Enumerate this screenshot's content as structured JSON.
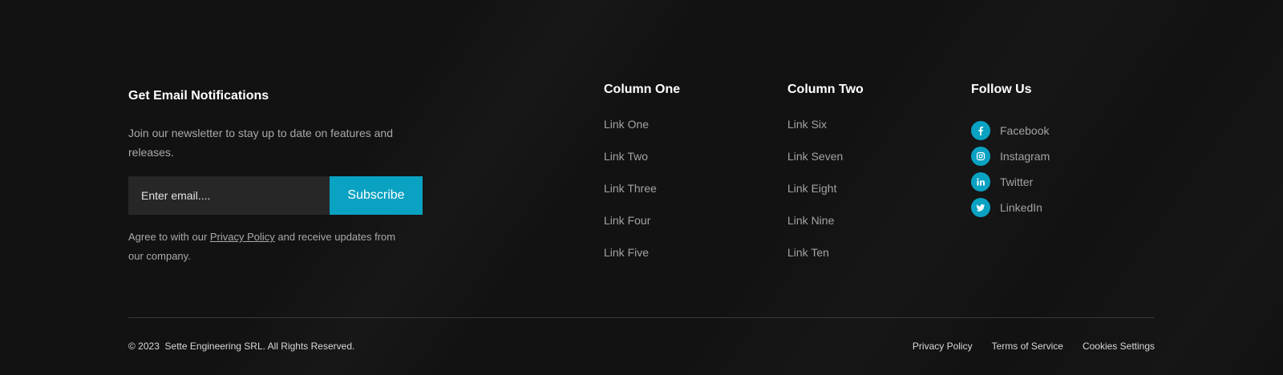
{
  "newsletter": {
    "title": "Get Email Notifications",
    "description": "Join our newsletter to stay up to date on features and releases.",
    "input_placeholder": "Enter email....",
    "subscribe_label": "Subscribe",
    "agree_prefix": "Agree to with our ",
    "agree_link": "Privacy Policy",
    "agree_suffix": " and receive updates from our company."
  },
  "column_one": {
    "title": "Column One",
    "links": [
      "Link One",
      "Link Two",
      "Link Three",
      "Link Four",
      "Link Five"
    ]
  },
  "column_two": {
    "title": "Column Two",
    "links": [
      "Link Six",
      "Link Seven",
      "Link Eight",
      "Link Nine",
      "Link Ten"
    ]
  },
  "follow": {
    "title": "Follow Us",
    "items": [
      {
        "label": "Facebook",
        "icon": "facebook-icon"
      },
      {
        "label": "Instagram",
        "icon": "instagram-icon"
      },
      {
        "label": "Twitter",
        "icon": "linkedin-in-icon"
      },
      {
        "label": "LinkedIn",
        "icon": "twitter-bird-icon"
      }
    ]
  },
  "bottom": {
    "copyright": "© 2023  Sette Engineering SRL. All Rights Reserved.",
    "links": [
      "Privacy Policy",
      "Terms of Service",
      "Cookies Settings"
    ]
  },
  "colors": {
    "background": "#121212",
    "accent": "#0aa2c2",
    "input_bg": "#272727",
    "muted_text": "#a3a3a3"
  }
}
